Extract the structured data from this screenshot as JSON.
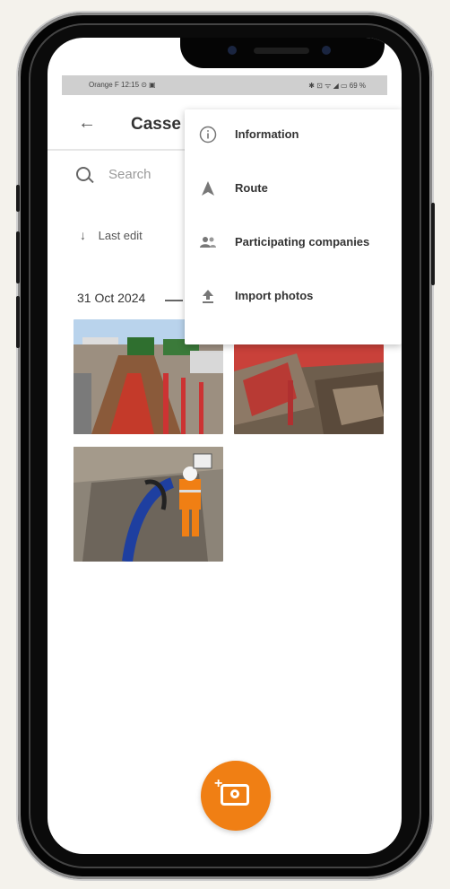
{
  "status_bar": {
    "left": "Orange F 12:15 ⊙ ▣",
    "right": "✱ ⊡ ᯤ ◢ ▭ 69 %"
  },
  "app_bar": {
    "title": "Casse",
    "filter_glyph": "≡"
  },
  "search": {
    "placeholder": "Search"
  },
  "sort": {
    "label": "Last edit"
  },
  "group": {
    "date": "31 Oct 2024"
  },
  "menu": {
    "items": [
      {
        "label": "Information",
        "icon": "info-icon"
      },
      {
        "label": "Route",
        "icon": "navigation-arrow-icon"
      },
      {
        "label": "Participating companies",
        "icon": "people-icon"
      },
      {
        "label": "Import photos",
        "icon": "upload-icon"
      }
    ]
  },
  "photos": [
    {
      "name": "street-trench-photo"
    },
    {
      "name": "excavation-photo"
    },
    {
      "name": "worker-pipe-photo"
    }
  ],
  "fab": {
    "icon": "add-photo-camera-icon"
  },
  "colors": {
    "accent": "#f07f14",
    "background": "#f4f2ec",
    "screen": "#ffffff"
  }
}
